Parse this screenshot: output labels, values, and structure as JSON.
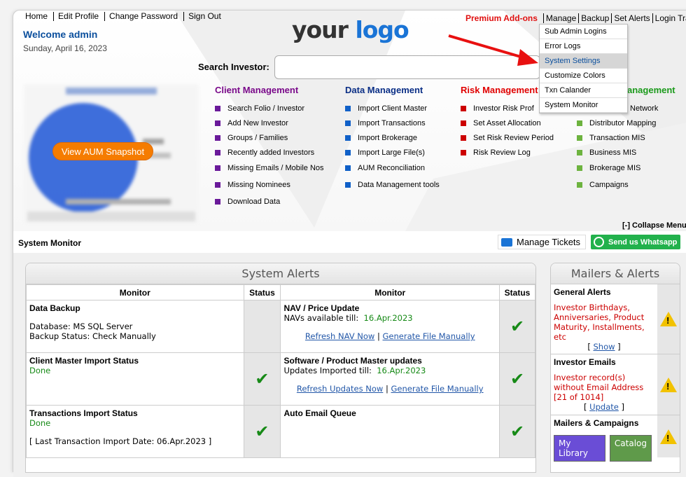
{
  "top_links": [
    "Home",
    "Edit Profile",
    "Change Password",
    "Sign Out"
  ],
  "welcome": "Welcome admin",
  "date": "Sunday, April 16, 2023",
  "logo": {
    "part1": "your",
    "part2": "logo"
  },
  "right_nav": {
    "premium": "Premium Add-ons",
    "links": [
      "Manage",
      "Backup",
      "Set Alerts",
      "Login Traffic"
    ]
  },
  "manage_menu": [
    "Sub Admin Logins",
    "Error Logs",
    "System Settings",
    "Customize Colors",
    "Txn Calander",
    "System Monitor"
  ],
  "search": {
    "label": "Search Investor:",
    "placeholder": ""
  },
  "aum_button": "View AUM Snapshot",
  "columns": [
    {
      "title": "Client Management",
      "color": "#7a0a8a",
      "bullet": "#6a1a9a",
      "items": [
        "Search Folio / Investor",
        "Add New Investor",
        "Groups / Families",
        "Recently added Investors",
        "Missing Emails / Mobile Nos",
        "Missing Nominees",
        "Download Data"
      ]
    },
    {
      "title": "Data Management",
      "color": "#0b2f86",
      "bullet": "#1060c8",
      "items": [
        "Import Client Master",
        "Import Transactions",
        "Import Brokerage",
        "Import Large File(s)",
        "AUM Reconciliation",
        "Data Management tools"
      ]
    },
    {
      "title": "Risk Management",
      "color": "#e00000",
      "bullet": "#cc0000",
      "items": [
        "Investor Risk Prof",
        "Set Asset Allocation",
        "Set Risk Review Period",
        "Risk Review Log"
      ]
    },
    {
      "title": "anagement",
      "color": "#1b9a1b",
      "bullet": "#6db33f",
      "items": [
        "Network",
        "Distributor Mapping",
        "Transaction MIS",
        "Business MIS",
        "Brokerage MIS",
        "Campaigns"
      ]
    }
  ],
  "collapse_menu": "[-] Collapse Menu",
  "system_monitor": {
    "title": "System Monitor",
    "manage_tickets": "Manage Tickets",
    "whatsapp": "Send us Whatsapp"
  },
  "system_alerts": {
    "title": "System Alerts",
    "headers": {
      "monitor": "Monitor",
      "status": "Status"
    },
    "left": [
      {
        "title": "Data Backup",
        "lines": [
          "Database: MS SQL Server",
          "Backup Status: Check Manually"
        ],
        "check": false
      },
      {
        "title": "Client Master Import Status",
        "status_text": "Done",
        "check": true
      },
      {
        "title": "Transactions Import Status",
        "status_text": "Done",
        "note": "[ Last Transaction Import Date: 06.Apr.2023 ]",
        "check": true
      }
    ],
    "right": [
      {
        "title": "NAV / Price Update",
        "label": "NAVs available till:",
        "value": "16.Apr.2023",
        "link1": "Refresh NAV Now",
        "link2": "Generate File Manually",
        "check": true
      },
      {
        "title": "Software / Product Master updates",
        "label": "Updates Imported till:",
        "value": "16.Apr.2023",
        "link1": "Refresh Updates Now",
        "link2": "Generate File Manually",
        "check": true
      },
      {
        "title": "Auto Email Queue",
        "check": true
      }
    ]
  },
  "mailers": {
    "title": "Mailers & Alerts",
    "general_title": "General Alerts",
    "general_text": "Investor Birthdays, Anniversaries, Product Maturity, Installments, etc",
    "show_link": "Show",
    "emails_title": "Investor Emails",
    "emails_text": "Investor record(s) without Email Address [21 of 1014]",
    "update_link": "Update",
    "campaigns_title": "Mailers & Campaigns",
    "btn_library": "My Library",
    "btn_catalog": "Catalog"
  },
  "colors": {
    "accent_blue": "#0b4f9d",
    "premium_red": "#e01010",
    "orange": "#f57c00",
    "whatsapp_green": "#22b14c"
  }
}
